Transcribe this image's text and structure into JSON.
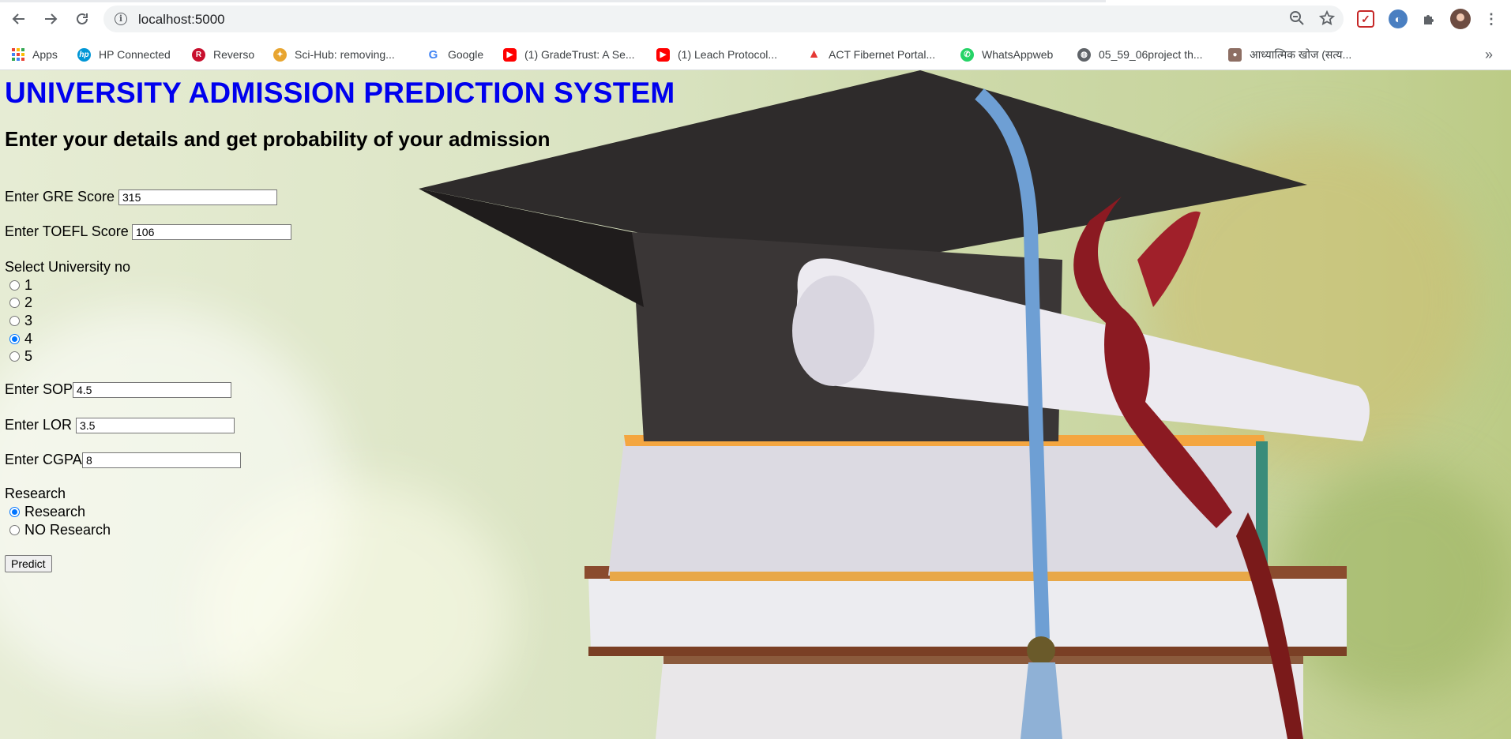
{
  "browser": {
    "url": "localhost:5000",
    "bookmarks": [
      {
        "label": "Apps",
        "icon": "apps-grid-icon",
        "color": "#1a73e8"
      },
      {
        "label": "HP Connected",
        "icon": "hp-icon",
        "color": "#0096d6"
      },
      {
        "label": "Reverso",
        "icon": "reverso-icon",
        "color": "#c8102e"
      },
      {
        "label": "Sci-Hub: removing...",
        "icon": "scihub-icon",
        "color": "#e8a530"
      },
      {
        "label": "Google",
        "icon": "google-icon",
        "color": "#4285f4"
      },
      {
        "label": "(1) GradeTrust: A Se...",
        "icon": "youtube-icon",
        "color": "#ff0000"
      },
      {
        "label": "(1) Leach Protocol...",
        "icon": "youtube-icon",
        "color": "#ff0000"
      },
      {
        "label": "ACT Fibernet Portal...",
        "icon": "act-icon",
        "color": "#e53935"
      },
      {
        "label": "WhatsAppweb",
        "icon": "whatsapp-icon",
        "color": "#25d366"
      },
      {
        "label": "05_59_06project th...",
        "icon": "globe-icon",
        "color": "#5f6368"
      },
      {
        "label": "आध्यात्मिक खोज (सत्य...",
        "icon": "person-thumb-icon",
        "color": "#8d6e63"
      }
    ]
  },
  "page": {
    "title": "UNIVERSITY ADMISSION PREDICTION SYSTEM",
    "subtitle": "Enter your details and get probability of your admission",
    "gre_label": "Enter GRE Score",
    "gre_value": "315",
    "toefl_label": "Enter TOEFL Score",
    "toefl_value": "106",
    "university_label": "Select University no",
    "university_options": [
      "1",
      "2",
      "3",
      "4",
      "5"
    ],
    "university_selected": "4",
    "sop_label": "Enter SOP",
    "sop_value": "4.5",
    "lor_label": "Enter LOR",
    "lor_value": "3.5",
    "cgpa_label": "Enter CGPA",
    "cgpa_value": "8",
    "research_label": "Research",
    "research_options": [
      "Research",
      "NO Research"
    ],
    "research_selected": "Research",
    "predict_label": "Predict"
  },
  "colors": {
    "title": "#0000ee",
    "radio_checked": "#0075ff"
  }
}
